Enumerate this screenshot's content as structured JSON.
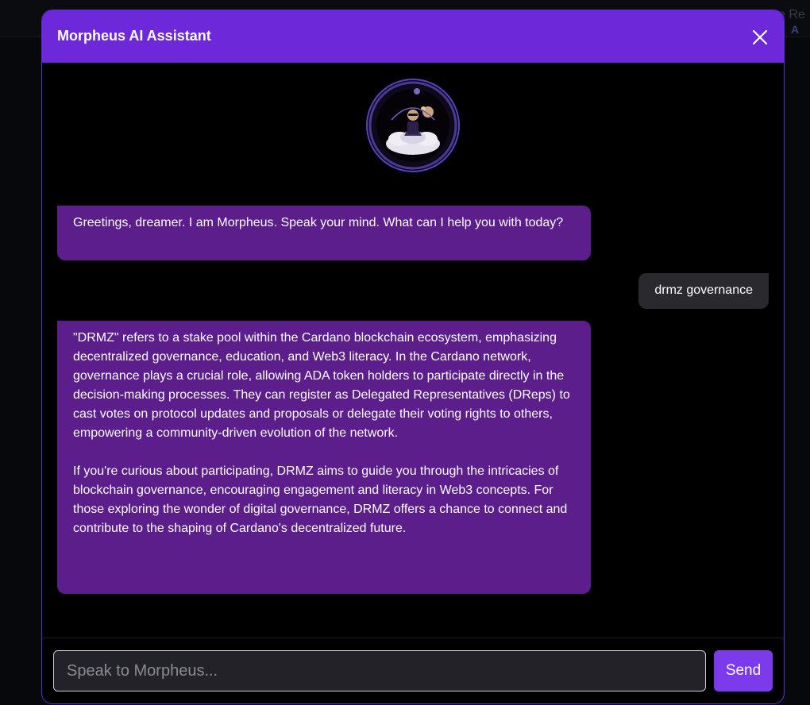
{
  "background": {
    "peek_line1": "e Re",
    "peek_line2": "A"
  },
  "modal": {
    "title": "Morpheus AI Assistant",
    "close_icon": "close-icon",
    "avatar_icon": "morpheus-avatar-icon"
  },
  "messages": [
    {
      "role": "assistant",
      "text": "Greetings, dreamer. I am Morpheus. Speak your mind. What can I help you with today?"
    },
    {
      "role": "user",
      "text": "drmz governance"
    },
    {
      "role": "assistant",
      "text": "\"DRMZ\" refers to a stake pool within the Cardano blockchain ecosystem, emphasizing decentralized governance, education, and Web3 literacy. In the Cardano network, governance plays a crucial role, allowing ADA token holders to participate directly in the decision-making processes. They can register as Delegated Representatives (DReps) to cast votes on protocol updates and proposals or delegate their voting rights to others, empowering a community-driven evolution of the network.\n\nIf you're curious about participating, DRMZ aims to guide you through the intricacies of blockchain governance, encouraging engagement and literacy in Web3 concepts. For those exploring the wonder of digital governance, DRMZ offers a chance to connect and contribute to the shaping of Cardano's decentralized future."
    }
  ],
  "composer": {
    "value": "",
    "placeholder": "Speak to Morpheus...",
    "send_label": "Send"
  },
  "colors": {
    "header": "#6d28d9",
    "assistant_bubble": "#5b1e8a",
    "user_bubble": "#2a2a2e",
    "send_button": "#7c3aed"
  }
}
